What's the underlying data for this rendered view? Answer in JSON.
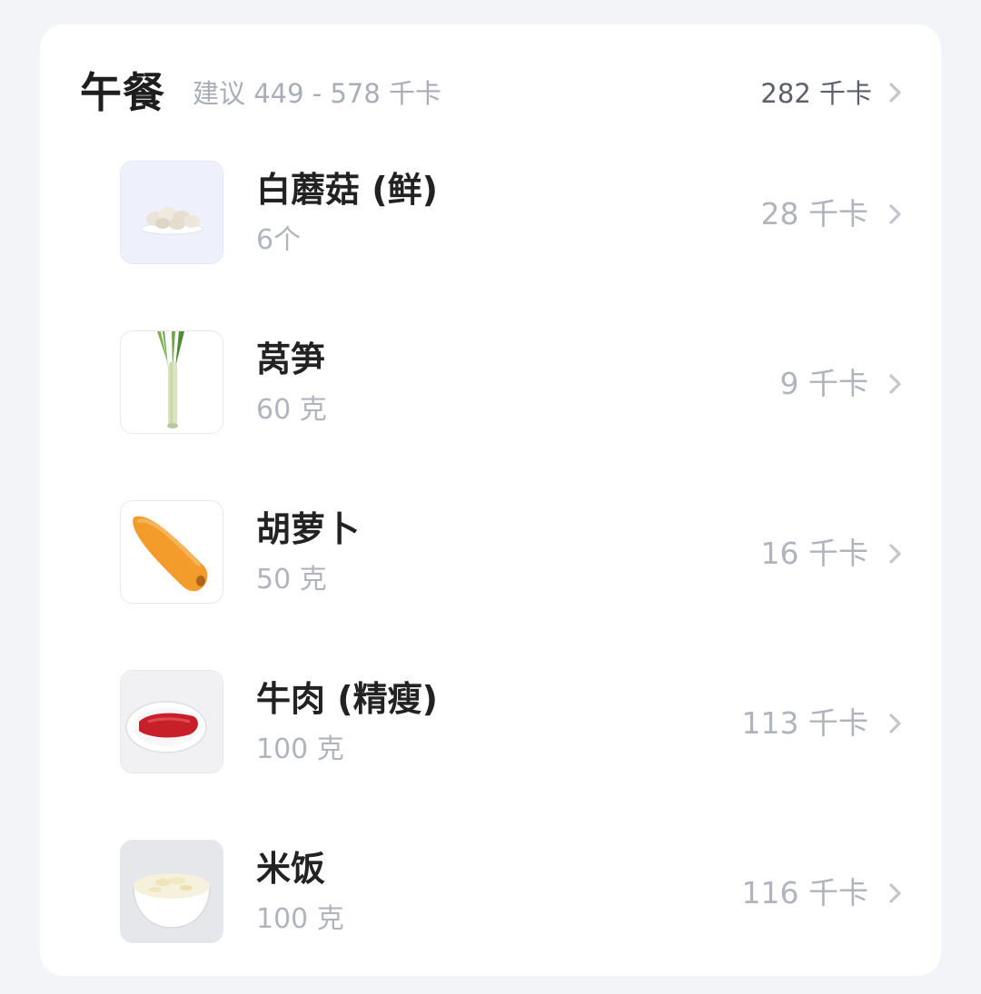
{
  "meal": {
    "title": "午餐",
    "suggestion": "建议 449 - 578 千卡",
    "total": "282 千卡"
  },
  "items": [
    {
      "name": "白蘑菇 (鲜)",
      "amount": "6个",
      "kcal": "28 千卡",
      "icon": "mushroom-image"
    },
    {
      "name": "莴笋",
      "amount": "60 克",
      "kcal": "9 千卡",
      "icon": "lettuce-stem-image"
    },
    {
      "name": "胡萝卜",
      "amount": "50 克",
      "kcal": "16 千卡",
      "icon": "carrot-image"
    },
    {
      "name": "牛肉 (精瘦)",
      "amount": "100 克",
      "kcal": "113 千卡",
      "icon": "beef-image"
    },
    {
      "name": "米饭",
      "amount": "100 克",
      "kcal": "116 千卡",
      "icon": "rice-image"
    }
  ],
  "colors": {
    "background": "#f3f4f8",
    "card": "#ffffff",
    "title": "#1e1e1e",
    "muted": "#b1b4bd",
    "total": "#5b5f6b"
  }
}
